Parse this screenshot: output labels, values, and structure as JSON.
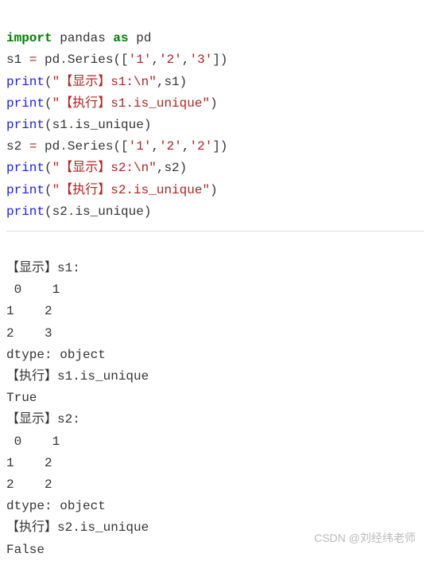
{
  "code": {
    "l1": {
      "kw1": "import",
      "id1": " pandas ",
      "kw2": "as",
      "id2": " pd"
    },
    "l2": {
      "a": "s1 ",
      "eq": "=",
      "b": " pd",
      "dot": ".",
      "fn": "Series",
      "p": "([",
      "s1": "'1'",
      "c1": ",",
      "s2": "'2'",
      "c2": ",",
      "s3": "'3'",
      "q": "])"
    },
    "l3": {
      "fn": "print",
      "p": "(",
      "s": "\"【显示】s1:\\n\"",
      "c": ",",
      "a": "s1",
      "q": ")"
    },
    "l4": {
      "fn": "print",
      "p": "(",
      "s": "\"【执行】s1.is_unique\"",
      "q": ")"
    },
    "l5": {
      "fn": "print",
      "p": "(",
      "a": "s1",
      "dot": ".",
      "attr": "is_unique",
      "q": ")"
    },
    "l6": {
      "a": "s2 ",
      "eq": "=",
      "b": " pd",
      "dot": ".",
      "fn": "Series",
      "p": "([",
      "s1": "'1'",
      "c1": ",",
      "s2": "'2'",
      "c2": ",",
      "s3": "'2'",
      "q": "])"
    },
    "l7": {
      "fn": "print",
      "p": "(",
      "s": "\"【显示】s2:\\n\"",
      "c": ",",
      "a": "s2",
      "q": ")"
    },
    "l8": {
      "fn": "print",
      "p": "(",
      "s": "\"【执行】s2.is_unique\"",
      "q": ")"
    },
    "l9": {
      "fn": "print",
      "p": "(",
      "a": "s2",
      "dot": ".",
      "attr": "is_unique",
      "q": ")"
    }
  },
  "output": {
    "lines": [
      "【显示】s1:",
      " 0    1",
      "1    2",
      "2    3",
      "dtype: object",
      "【执行】s1.is_unique",
      "True",
      "【显示】s2:",
      " 0    1",
      "1    2",
      "2    2",
      "dtype: object",
      "【执行】s2.is_unique",
      "False"
    ]
  },
  "watermark": "CSDN @刘经纬老师"
}
